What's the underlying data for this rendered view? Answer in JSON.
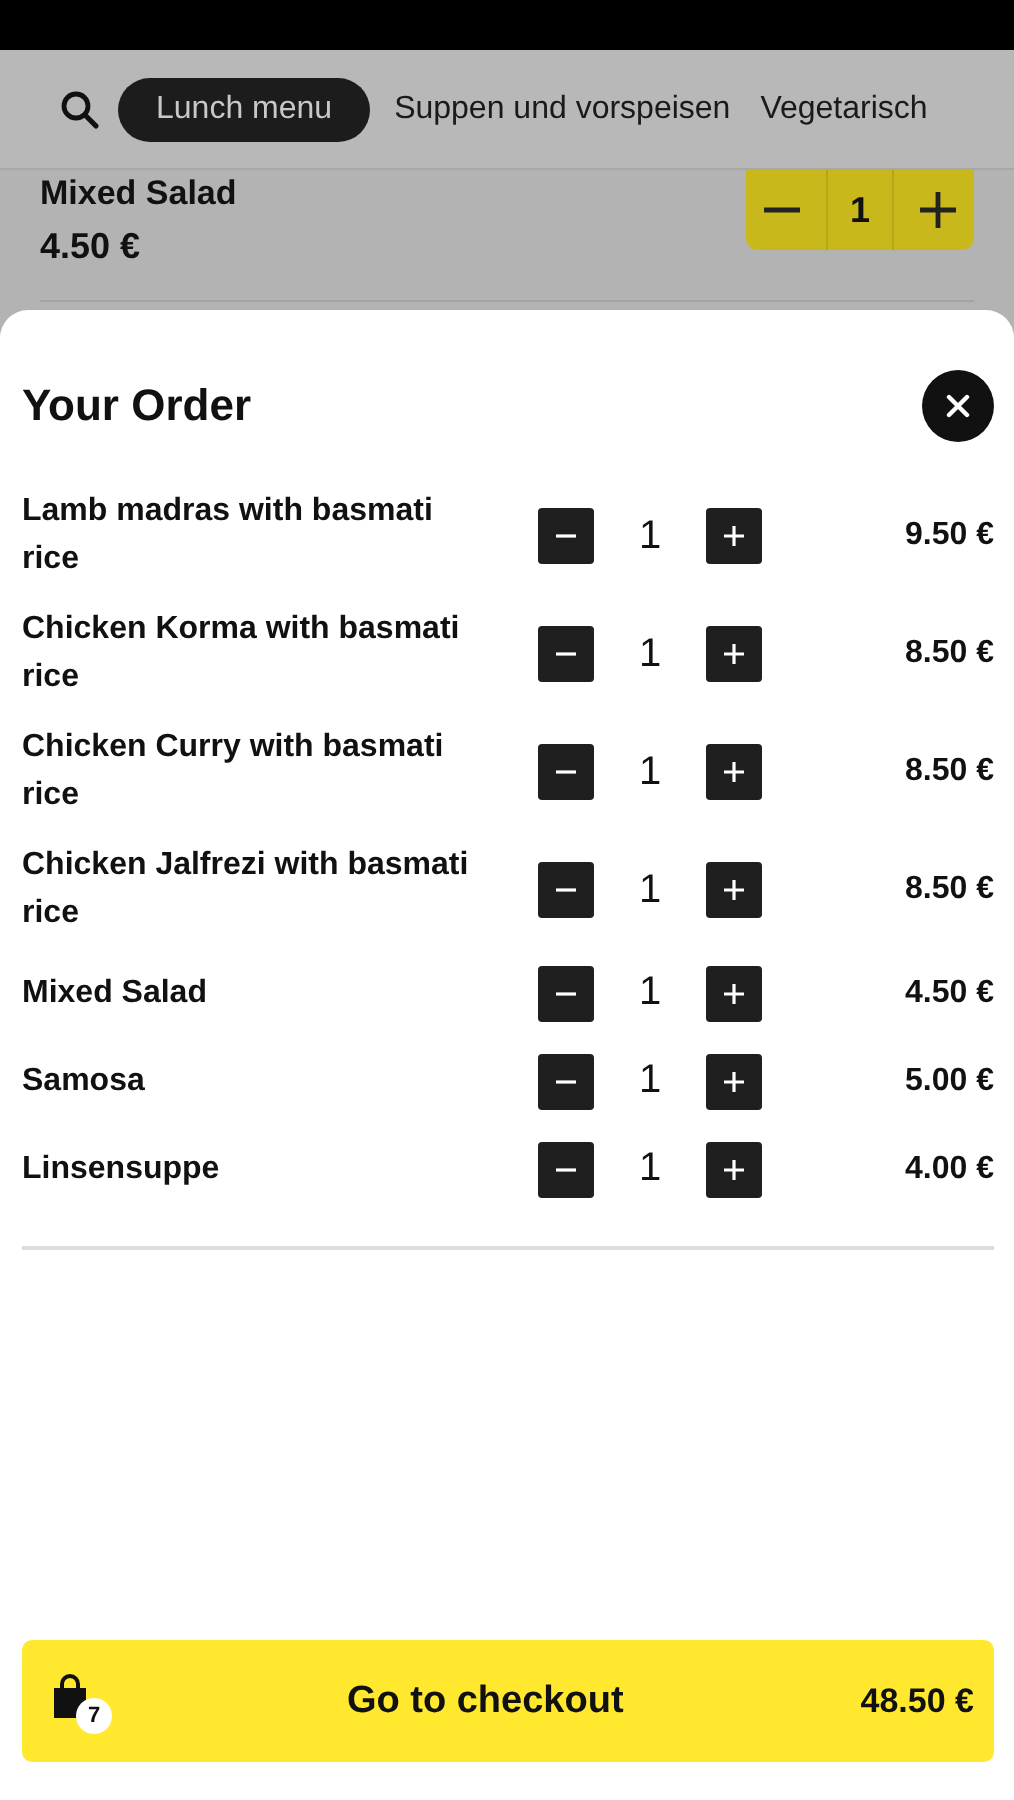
{
  "tabs": [
    {
      "label": "Lunch menu",
      "selected": true
    },
    {
      "label": "Suppen und vorspeisen",
      "selected": false
    },
    {
      "label": "Vegetarisch",
      "selected": false
    }
  ],
  "menu_item": {
    "name": "Mixed Salad",
    "price": "4.50 €",
    "quantity": "1"
  },
  "order": {
    "title": "Your Order",
    "items": [
      {
        "name": "Lamb madras with basmati rice",
        "quantity": "1",
        "price": "9.50 €"
      },
      {
        "name": "Chicken Korma with basmati rice",
        "quantity": "1",
        "price": "8.50 €"
      },
      {
        "name": "Chicken Curry with basmati rice",
        "quantity": "1",
        "price": "8.50 €"
      },
      {
        "name": "Chicken Jalfrezi with basmati rice",
        "quantity": "1",
        "price": "8.50 €"
      },
      {
        "name": "Mixed Salad",
        "quantity": "1",
        "price": "4.50 €"
      },
      {
        "name": "Samosa",
        "quantity": "1",
        "price": "5.00 €"
      },
      {
        "name": "Linsensuppe",
        "quantity": "1",
        "price": "4.00 €"
      }
    ]
  },
  "checkout": {
    "label": "Go to checkout",
    "count": "7",
    "total": "48.50 €"
  }
}
